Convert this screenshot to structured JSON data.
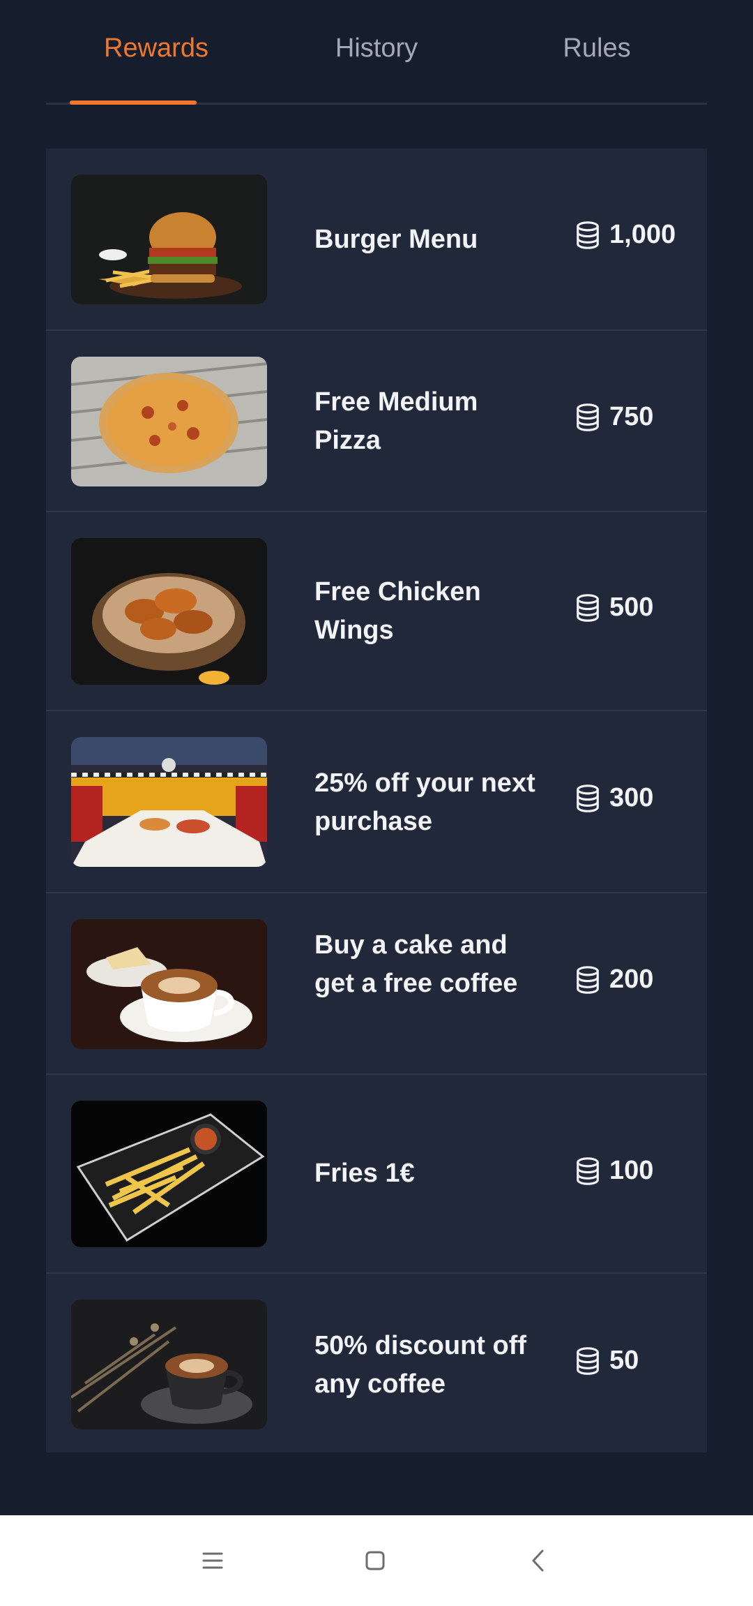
{
  "tabs": [
    {
      "label": "Rewards",
      "active": true
    },
    {
      "label": "History",
      "active": false
    },
    {
      "label": "Rules",
      "active": false
    }
  ],
  "rewards": [
    {
      "title": "Burger Menu",
      "points": "1,000",
      "image": "burger-menu-photo"
    },
    {
      "title": "Free Medium Pizza",
      "points": "750",
      "image": "pizza-photo"
    },
    {
      "title": "Free Chicken Wings",
      "points": "500",
      "image": "chicken-wings-photo"
    },
    {
      "title": "25% off your next purchase",
      "points": "300",
      "image": "diner-table-photo"
    },
    {
      "title": "Buy a cake and get a free coffee",
      "points": "200",
      "image": "cake-and-coffee-photo"
    },
    {
      "title": "Fries 1€",
      "points": "100",
      "image": "fries-photo"
    },
    {
      "title": "50% discount off any coffee",
      "points": "50",
      "image": "coffee-photo"
    }
  ],
  "icons": {
    "points": "coins-stack-icon"
  },
  "navbar": {
    "buttons": [
      "menu-icon",
      "home-icon",
      "back-icon"
    ]
  },
  "colors": {
    "accent": "#f0782e",
    "background": "#161d2c",
    "card": "#202839"
  }
}
